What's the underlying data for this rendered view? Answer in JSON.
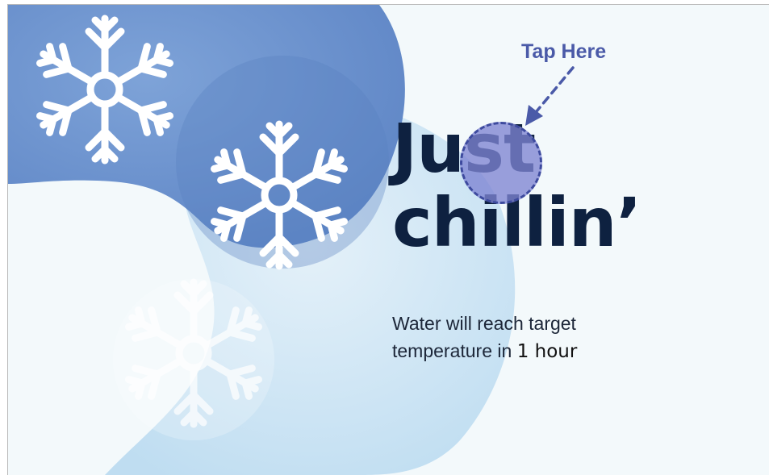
{
  "hero": {
    "title_line1": "Just",
    "title_line2": "chillin’",
    "subtitle_line1": "Water will reach target",
    "subtitle_line2_prefix": "temperature in ",
    "duration": "1 hour"
  },
  "hint": {
    "label": "Tap Here"
  },
  "icons": [
    "snowflake-icon",
    "snowflake-icon",
    "snowflake-icon"
  ],
  "colors": {
    "background": "#f3f9fb",
    "blob_dark": "#6d94cf",
    "blob_light": "#c9e3f3",
    "title": "#0e2140",
    "tap_circle": "#7e84d2",
    "hint": "#4a5aa8"
  }
}
